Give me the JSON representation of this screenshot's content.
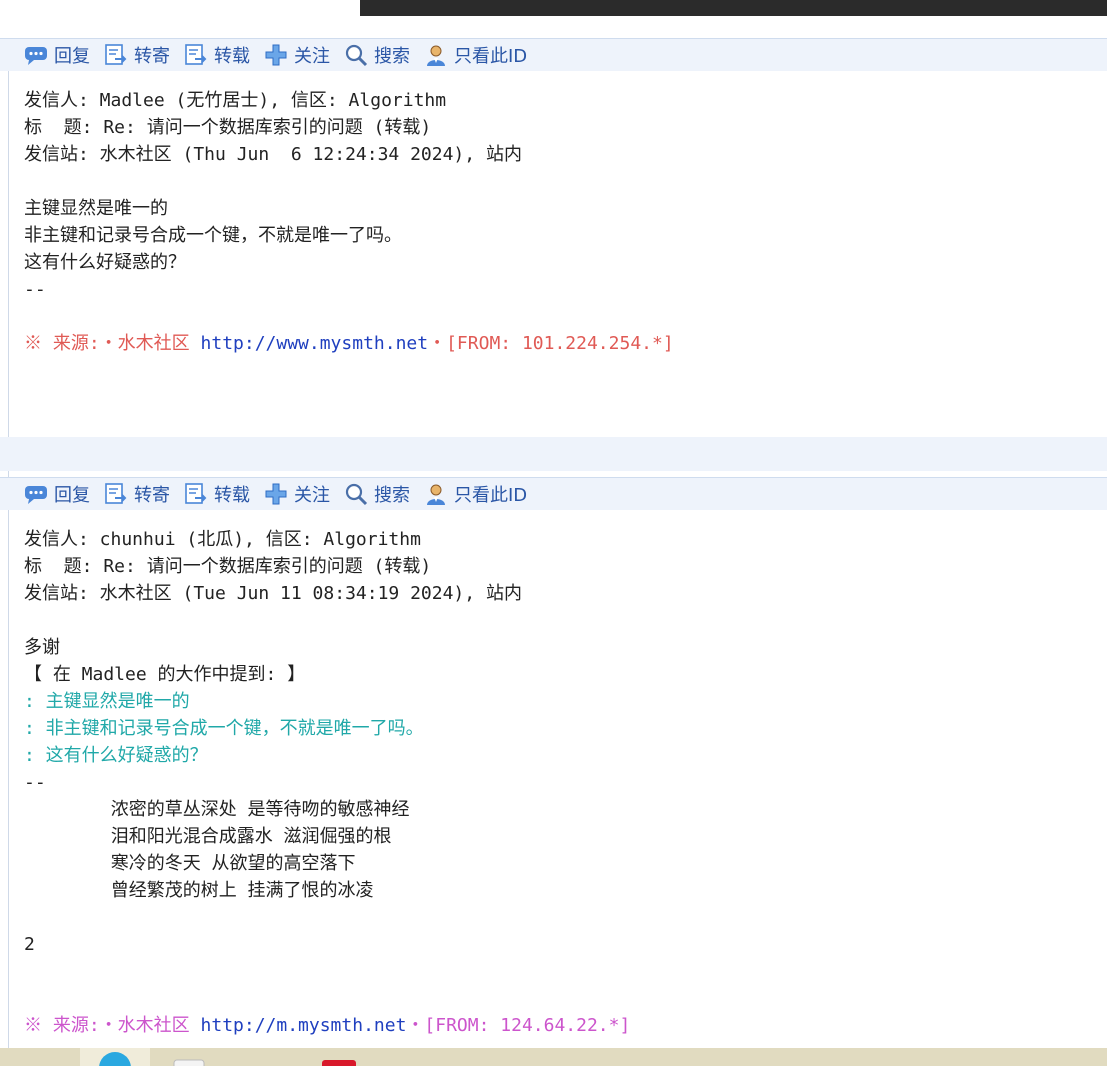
{
  "toolbar": {
    "reply": "回复",
    "forward": "转寄",
    "repost": "转载",
    "follow": "关注",
    "search": "搜索",
    "only_this_id": "只看此ID"
  },
  "posts": [
    {
      "header": [
        "发信人: Madlee (无竹居士), 信区: Algorithm",
        "标  题: Re: 请问一个数据库索引的问题 (转载)",
        "发信站: 水木社区 (Thu Jun  6 12:24:34 2024), 站内"
      ],
      "body": [
        "主键显然是唯一的",
        "非主键和记录号合成一个键，不就是唯一了吗。",
        "这有什么好疑惑的？",
        "--"
      ],
      "source_prefix": "※ 来源:・水木社区 ",
      "source_url": "http://www.mysmth.net",
      "source_suffix": "・[FROM: 101.224.254.*]"
    },
    {
      "header": [
        "发信人: chunhui (北瓜), 信区: Algorithm",
        "标  题: Re: 请问一个数据库索引的问题 (转载)",
        "发信站: 水木社区 (Tue Jun 11 08:34:19 2024), 站内"
      ],
      "body_intro": "多谢",
      "quote_header": "【 在 Madlee 的大作中提到: 】",
      "quoted": [
        ": 主键显然是唯一的",
        ": 非主键和记录号合成一个键，不就是唯一了吗。",
        ": 这有什么好疑惑的？"
      ],
      "signature_sep": "--",
      "signature": [
        "        浓密的草丛深处 是等待吻的敏感神经",
        "        泪和阳光混合成露水 滋润倔强的根",
        "        寒冷的冬天 从欲望的高空落下",
        "        曾经繁茂的树上 挂满了恨的冰凌"
      ],
      "tail": "2",
      "source_prefix": "※ 来源:・水木社区 ",
      "source_url": "http://m.mysmth.net",
      "source_suffix": "・[FROM: 124.64.22.*]"
    }
  ],
  "colors": {
    "toolbar_bg": "#eef3fb",
    "link_blue": "#2a56a6",
    "source_red": "#e05a55",
    "source_pink": "#cc55cc",
    "quote_cyan": "#20a8a8"
  }
}
